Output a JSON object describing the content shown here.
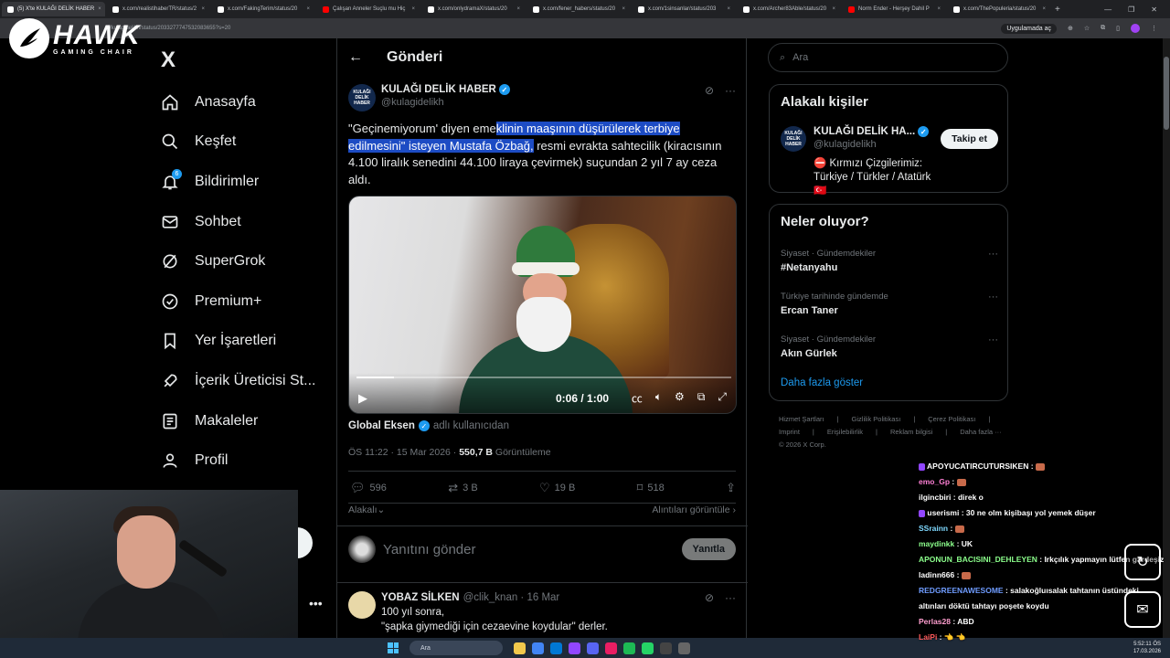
{
  "browser": {
    "tabs": [
      {
        "title": "(5) X'te KULAĞI DELİK HABER",
        "active": true
      },
      {
        "title": "x.com/realistihaberTR/status/2"
      },
      {
        "title": "x.com/FakingTerim/status/20"
      },
      {
        "title": "Çalışan Anneler Suçlu mu Hiç",
        "youtube": true
      },
      {
        "title": "x.com/onlydramaX/status/20"
      },
      {
        "title": "x.com/fener_habers/status/20"
      },
      {
        "title": "x.com/1sinsanlar/status/203"
      },
      {
        "title": "x.com/Archer83Able/status/20"
      },
      {
        "title": "Norm Ender - Herşey Dahil P",
        "youtube": true
      },
      {
        "title": "x.com/ThePopuleria/status/20"
      }
    ],
    "url": "/kulagidelikh/status/2033277747532083655?s=20",
    "app_button": "Uygulamada aç"
  },
  "overlay_logo": {
    "name": "HAWK",
    "sub": "GAMING CHAIR"
  },
  "sidebar": {
    "logo": "X",
    "notif_count": "6",
    "items": [
      {
        "label": "Anasayfa",
        "icon": "home-icon"
      },
      {
        "label": "Keşfet",
        "icon": "search-icon"
      },
      {
        "label": "Bildirimler",
        "icon": "bell-icon"
      },
      {
        "label": "Sohbet",
        "icon": "mail-icon"
      },
      {
        "label": "SuperGrok",
        "icon": "grok-icon"
      },
      {
        "label": "Premium+",
        "icon": "verified-icon"
      },
      {
        "label": "Yer İşaretleri",
        "icon": "bookmark-icon"
      },
      {
        "label": "İçerik Üreticisi St...",
        "icon": "rocket-icon"
      },
      {
        "label": "Makaleler",
        "icon": "article-icon"
      },
      {
        "label": "Profil",
        "icon": "person-icon"
      }
    ],
    "more": "•••"
  },
  "main": {
    "title": "Gönderi",
    "tweet": {
      "author": "KULAĞI DELİK HABER",
      "handle": "@kulagidelikh",
      "avatar_text": "KULAĞI DELİK HABER",
      "text_pre": "\"Geçinemiyorum' diyen eme",
      "text_hl": "klinin maaşının düşürülerek terbiye edilmesini\" isteyen Mustafa Özbağ,",
      "text_post": " resmi evrakta sahtecilik (kiracısının 4.100 liralık senedini 44.100 liraya çevirmek) suçundan 2 yıl 7 ay ceza aldı.",
      "video_time": "0:06 / 1:00",
      "video_progress": 0.1,
      "source_name": "Global Eksen",
      "source_suffix": "adlı kullanıcıdan",
      "time": "ÖS 11:22 · 15 Mar 2026 · ",
      "views": "550,7 B",
      "views_label": "Görüntüleme",
      "replies": "596",
      "reposts": "3 B",
      "likes": "19 B",
      "bookmarks": "518",
      "relevance": "Alakalı",
      "quotes": "Alıntıları görüntüle"
    },
    "reply_placeholder": "Yanıtını gönder",
    "reply_button": "Yanıtla",
    "reply": {
      "name": "YOBAZ SİLKEN",
      "handle": "@clik_knan · 16 Mar",
      "line1": "100 yıl sonra,",
      "line2": "\"şapka giymediği için cezaevine koydular\" derler."
    }
  },
  "right": {
    "search_placeholder": "Ara",
    "who": {
      "title": "Alakalı kişiler",
      "name": "KULAĞI DELİK HA...",
      "handle": "@kulagidelikh",
      "bio": "⛔ Kırmızı Çizgilerimiz: Türkiye / Türkler / Atatürk 🇹🇷",
      "follow": "Takip et"
    },
    "trends": {
      "title": "Neler oluyor?",
      "items": [
        {
          "context": "Siyaset · Gündemdekiler",
          "topic": "#Netanyahu"
        },
        {
          "context": "Türkiye tarihinde gündemde",
          "topic": "Ercan Taner"
        },
        {
          "context": "Siyaset · Gündemdekiler",
          "topic": "Akın Gürlek"
        }
      ],
      "show_more": "Daha fazla göster"
    },
    "footer": [
      "Hizmet Şartları",
      "|",
      "Gizlilik Politikası",
      "|",
      "Çerez Politikası",
      "|",
      "Imprint",
      "|",
      "Erişilebilirlik",
      "|",
      "Reklam bilgisi",
      "|",
      "Daha fazla ···",
      "© 2026 X Corp."
    ]
  },
  "chat": [
    {
      "user": "APOYUCATIRCUTURSIKEN",
      "text": " : ",
      "emote": true,
      "color": "#ffffff",
      "badge": true
    },
    {
      "user": "emo_Gp",
      "text": " : ",
      "emote": true,
      "color": "#ff7fd5"
    },
    {
      "user": "ilgincbiri",
      "text": " : direk o",
      "color": "#ffffff"
    },
    {
      "user": "userismi",
      "text": " : 30 ne olm kişibaşı yol yemek düşer",
      "color": "#ffffff",
      "badge": true
    },
    {
      "user": "SSrainn",
      "text": " : ",
      "emote": true,
      "color": "#7fd9ff"
    },
    {
      "user": "maydinkk",
      "text": " : UK",
      "color": "#8cff8c"
    },
    {
      "user": "APONUN_BACISINI_DEHLEYEN",
      "text": " : Irkçılık yapmayın lütfen gardeşiz",
      "color": "#8cff8c"
    },
    {
      "user": "ladinn666",
      "text": " : ",
      "emote": true,
      "color": "#ffffff"
    },
    {
      "user": "REDGREENAWESOME",
      "text": " : salakoğluısalak tahtanın üstündeki altınları döktü tahtayı poşete koydu",
      "color": "#6f9cff"
    },
    {
      "user": "Perlas28",
      "text": " : ABD",
      "color": "#ff9ecf"
    },
    {
      "user": "LaiPi",
      "text": " : 👈 👈",
      "color": "#ff5a5a"
    }
  ],
  "taskbar": {
    "search": "Ara",
    "time": "5:52:11 ÖS",
    "date": "17.03.2026"
  }
}
